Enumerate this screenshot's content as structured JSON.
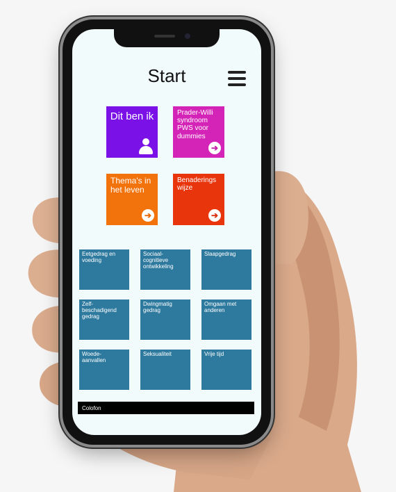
{
  "app": {
    "title": "Start"
  },
  "tiles": [
    {
      "label": "Dit ben ik",
      "color": "#7a12e8",
      "icon": "person-icon"
    },
    {
      "label": "Prader-Willi syndroom PWS voor dummies",
      "color": "#d424b7",
      "icon": "arrow-right-circle-icon"
    },
    {
      "label": "Thema's in het leven",
      "color": "#f2720c",
      "icon": "arrow-right-circle-icon"
    },
    {
      "label": "Benaderings wijze",
      "color": "#e8350c",
      "icon": "arrow-right-circle-icon"
    }
  ],
  "topics": [
    "Eetgedrag en voeding",
    "Sociaal-cognitieve ontwikkeling",
    "Slaapgedrag",
    "Zelf-beschadigend gedrag",
    "Dwingmatig gedrag",
    "Omgaan met anderen",
    "Woede-aanvallen",
    "Seksualiteit",
    "Vrije tijd"
  ],
  "footer": {
    "label": "Colofon"
  },
  "colors": {
    "topic_tile": "#2e7a9e",
    "screen_bg": "#f2fbfb"
  }
}
